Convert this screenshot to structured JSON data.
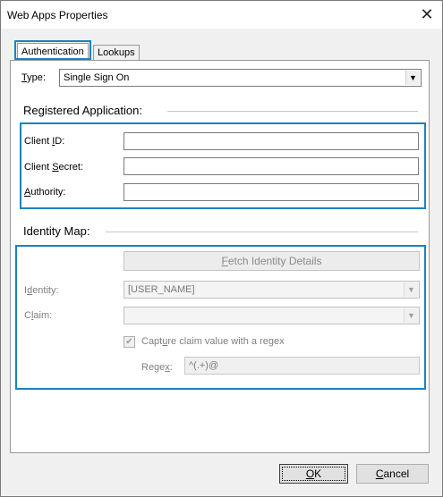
{
  "window": {
    "title": "Web Apps Properties"
  },
  "tabs": [
    {
      "label": "Authentication",
      "active": true
    },
    {
      "label": "Lookups",
      "active": false
    }
  ],
  "type_field": {
    "label_pre": "",
    "label_mn": "T",
    "label_post": "ype:",
    "value": "Single Sign On"
  },
  "registered_application": {
    "title": "Registered Application:",
    "client_id": {
      "label_pre": "Client ",
      "label_mn": "I",
      "label_post": "D:",
      "value": ""
    },
    "client_secret": {
      "label_pre": "Client ",
      "label_mn": "S",
      "label_post": "ecret:",
      "value": ""
    },
    "authority": {
      "label_pre": "",
      "label_mn": "A",
      "label_post": "uthority:",
      "value": ""
    }
  },
  "identity_map": {
    "title": "Identity Map:",
    "fetch_button": {
      "label_pre": "",
      "label_mn": "F",
      "label_post": "etch Identity Details"
    },
    "identity": {
      "label_pre": "I",
      "label_mn": "d",
      "label_post": "entity:",
      "value": "[USER_NAME]"
    },
    "claim": {
      "label_pre": "C",
      "label_mn": "l",
      "label_post": "aim:",
      "value": ""
    },
    "capture_regex": {
      "checked": true,
      "label_pre": "Capt",
      "label_mn": "u",
      "label_post": "re claim value with a regex"
    },
    "regex": {
      "label_pre": "Rege",
      "label_mn": "x",
      "label_post": ":",
      "value": "^(.+)@"
    }
  },
  "footer": {
    "ok": {
      "label_pre": "",
      "label_mn": "O",
      "label_post": "K"
    },
    "cancel": {
      "label_pre": "",
      "label_mn": "C",
      "label_post": "ancel"
    }
  },
  "colors": {
    "focus_highlight": "#1c82c0",
    "disabled_text": "#808080"
  }
}
